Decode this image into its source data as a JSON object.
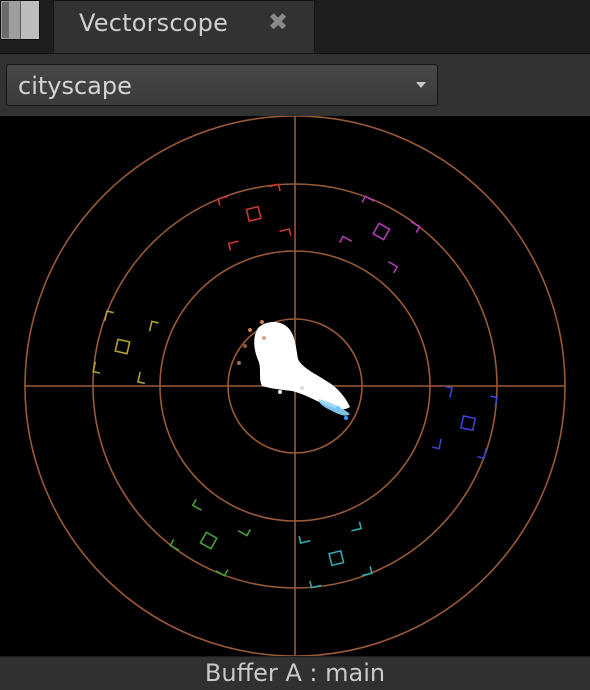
{
  "panel": {
    "menu_icon": "panel-menu-icon"
  },
  "tab": {
    "title": "Vectorscope",
    "close_icon": "close-icon",
    "close_glyph": "✖"
  },
  "viewer": {
    "selected": "cityscape",
    "dropdown_icon": "chevron-down-icon"
  },
  "scope": {
    "graticule_color": "#9a5a37",
    "targets": [
      {
        "name": "R",
        "color": "#c83a32"
      },
      {
        "name": "Mg",
        "color": "#b03eb4"
      },
      {
        "name": "B",
        "color": "#3b43cf"
      },
      {
        "name": "Cy",
        "color": "#36a7ad"
      },
      {
        "name": "G",
        "color": "#46a23a"
      },
      {
        "name": "Yl",
        "color": "#aea036"
      }
    ],
    "trace_color": "#ffffff",
    "trace_tint_color": "#8fd6ff"
  },
  "status": {
    "text": "Buffer A : main"
  }
}
